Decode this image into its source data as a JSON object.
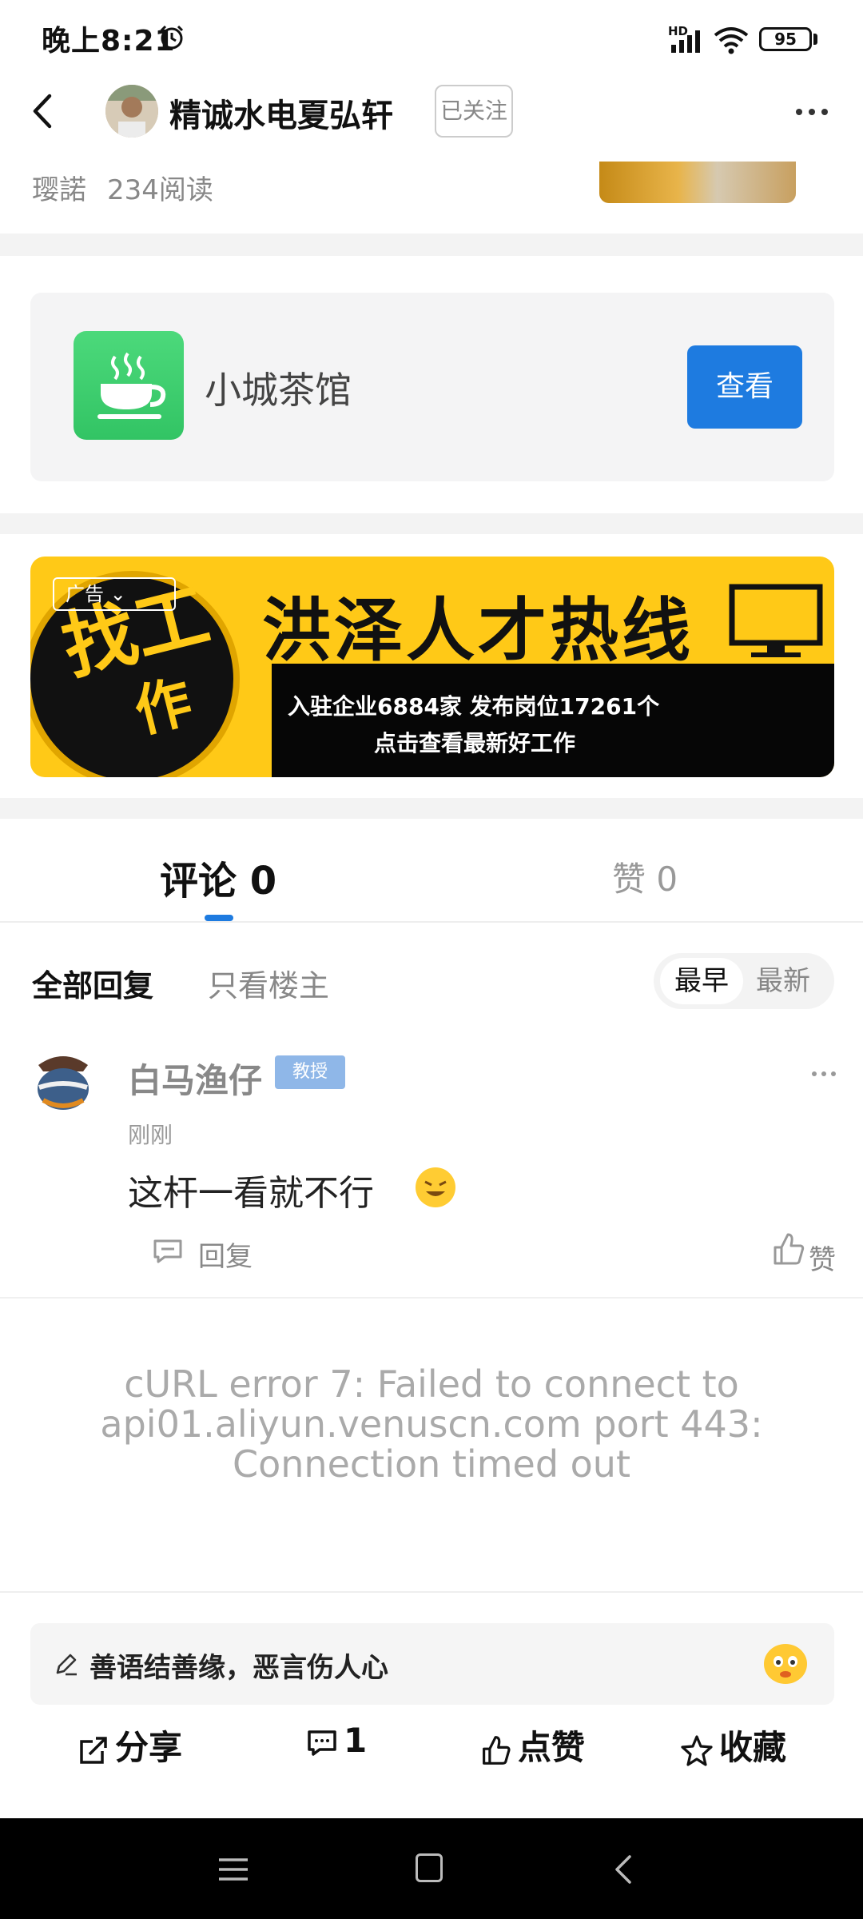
{
  "status_bar": {
    "time": "晚上8:21",
    "network": "HD",
    "battery": "95"
  },
  "header": {
    "author_name": "精诚水电夏弘轩",
    "follow_label": "已关注"
  },
  "post_meta": {
    "author": "璎諾",
    "reads": "234阅读"
  },
  "mini_program": {
    "name": "小城茶馆",
    "button": "查看"
  },
  "ad_banner": {
    "tag": "广告",
    "circle_text_1": "找工",
    "circle_text_2": "作",
    "title": "洪泽人才热线",
    "line1": "入驻企业6884家  发布岗位17261个",
    "line2": "点击查看最新好工作"
  },
  "tabs": {
    "comments": "评论 0",
    "likes": "赞 0"
  },
  "filters": {
    "all": "全部回复",
    "op_only": "只看楼主",
    "sort_earliest": "最早",
    "sort_newest": "最新"
  },
  "comment": {
    "user": "白马渔仔",
    "badge": "教授",
    "time": "刚刚",
    "text": "这杆一看就不行",
    "reply": "回复",
    "like": "赞"
  },
  "error": {
    "message": "cURL error 7: Failed to connect to api01.aliyun.venuscn.com port 443: Connection timed out"
  },
  "bottom": {
    "input_placeholder": "善语结善缘，恶言伤人心",
    "share": "分享",
    "comment_count": "1",
    "like": "点赞",
    "favorite": "收藏"
  },
  "colors": {
    "accent": "#1e7be0",
    "banner_yellow": "#ffc917",
    "badge_blue": "#8fb7e8"
  }
}
